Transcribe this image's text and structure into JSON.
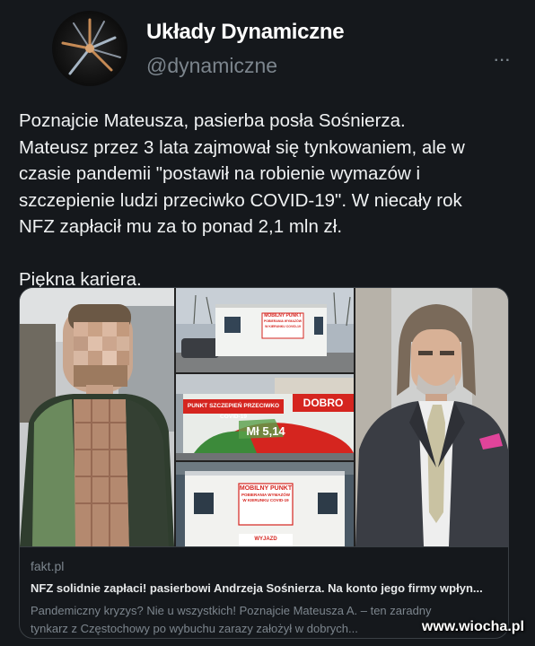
{
  "author": {
    "display_name": "Układy Dynamiczne",
    "handle": "@dynamiczne",
    "avatar_icon": "spark-icon"
  },
  "more_icon": "more-dots-icon",
  "more_label": "···",
  "tweet": {
    "lines": [
      "Poznajcie Mateusza, pasierba posła Sośnierza.",
      "Mateusz przez 3 lata zajmował się tynkowaniem, ale w",
      "czasie pandemii \"postawił na robienie wymazów i",
      "szczepienie ludzi przeciwko COVID-19\". W niecały rok",
      "NFZ zapłacił mu za to ponad 2,1 mln zł."
    ],
    "closing": "Piękna kariera."
  },
  "card": {
    "domain": "fakt.pl",
    "title": "NFZ solidnie zapłaci! pasierbowi Andrzeja Sośnierza. Na konto jego firmy wpłyn...",
    "description_lines": [
      "Pandemiczny kryzys? Nie u wszystkich! Poznajcie Mateusza A. – ten zaradny",
      "tynkarz z Częstochowy po wybuchu zarazy założył w dobrych..."
    ],
    "images": {
      "sign_top": [
        "MOBILNY PUNKT",
        "POBIERANIA WYMAZÓW",
        "W KIERUNKU COVID-19"
      ],
      "sign_middle_banner": "PUNKT SZCZEPIEŃ PRZECIWKO COVID-19",
      "sign_middle_right": "DOBRO",
      "sign_middle_graffiti": "Mł 5,14",
      "sign_bottom": [
        "MOBILNY PUNKT",
        "POBIERANIA WYMAZÓW",
        "W KIERUNKU COVID-19"
      ],
      "sign_bottom_small": "WYJAZD"
    }
  },
  "watermark": "www.wiocha.pl",
  "colors": {
    "background": "#15181c",
    "text": "#e7e9ea",
    "muted": "#7c858d",
    "border": "#3a3f44",
    "sign_red": "#d5251f"
  }
}
